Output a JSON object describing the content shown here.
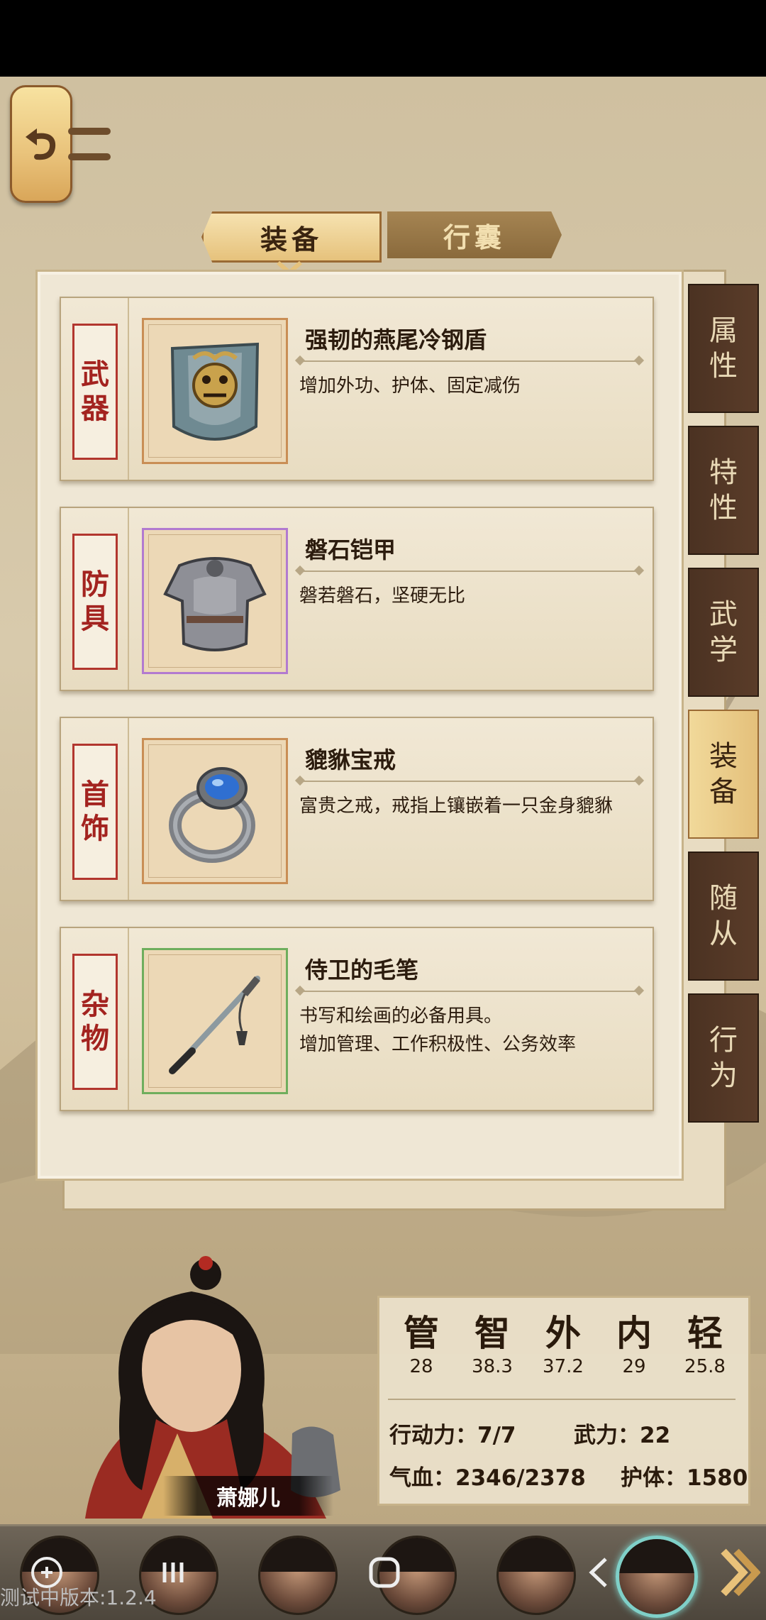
{
  "tabs": {
    "equip": "装备",
    "bag": "行囊"
  },
  "slots": [
    {
      "label": [
        "武",
        "器"
      ],
      "name": "强韧的燕尾冷钢盾",
      "desc": "增加外功、护体、固定减伤",
      "icon": "shield-icon",
      "rarity": "orange"
    },
    {
      "label": [
        "防",
        "具"
      ],
      "name": "磐石铠甲",
      "desc": "磐若磐石，坚硬无比",
      "icon": "armor-icon",
      "rarity": "purple"
    },
    {
      "label": [
        "首",
        "饰"
      ],
      "name": "貔貅宝戒",
      "desc": "富贵之戒，戒指上镶嵌着一只金身貔貅",
      "icon": "ring-icon",
      "rarity": "orange"
    },
    {
      "label": [
        "杂",
        "物"
      ],
      "name": "侍卫的毛笔",
      "desc": "书写和绘画的必备用具。\n增加管理、工作积极性、公务效率",
      "icon": "brush-icon",
      "rarity": "green"
    }
  ],
  "side_tabs": [
    {
      "chars": [
        "属",
        "性"
      ]
    },
    {
      "chars": [
        "特",
        "性"
      ]
    },
    {
      "chars": [
        "武",
        "学"
      ]
    },
    {
      "chars": [
        "装",
        "备"
      ],
      "active": true
    },
    {
      "chars": [
        "随",
        "从"
      ]
    },
    {
      "chars": [
        "行",
        "为"
      ]
    }
  ],
  "character": {
    "name": "萧娜儿",
    "stats": [
      {
        "char": "管",
        "value": "28"
      },
      {
        "char": "智",
        "value": "38.3"
      },
      {
        "char": "外",
        "value": "37.2"
      },
      {
        "char": "内",
        "value": "29"
      },
      {
        "char": "轻",
        "value": "25.8"
      }
    ],
    "action_power": "行动力：7/7",
    "martial_power": "武力：22",
    "hp": "气血：2346/2378",
    "defense": "护体：1580"
  },
  "version": "测试中版本:1.2.4",
  "colors": {
    "accent_gold": "#e9c27a",
    "label_red": "#a3231f",
    "rarity_orange": "#c98e55",
    "rarity_purple": "#b27ad0",
    "rarity_green": "#6fae5d",
    "selected_avatar": "#7fd0c8"
  }
}
